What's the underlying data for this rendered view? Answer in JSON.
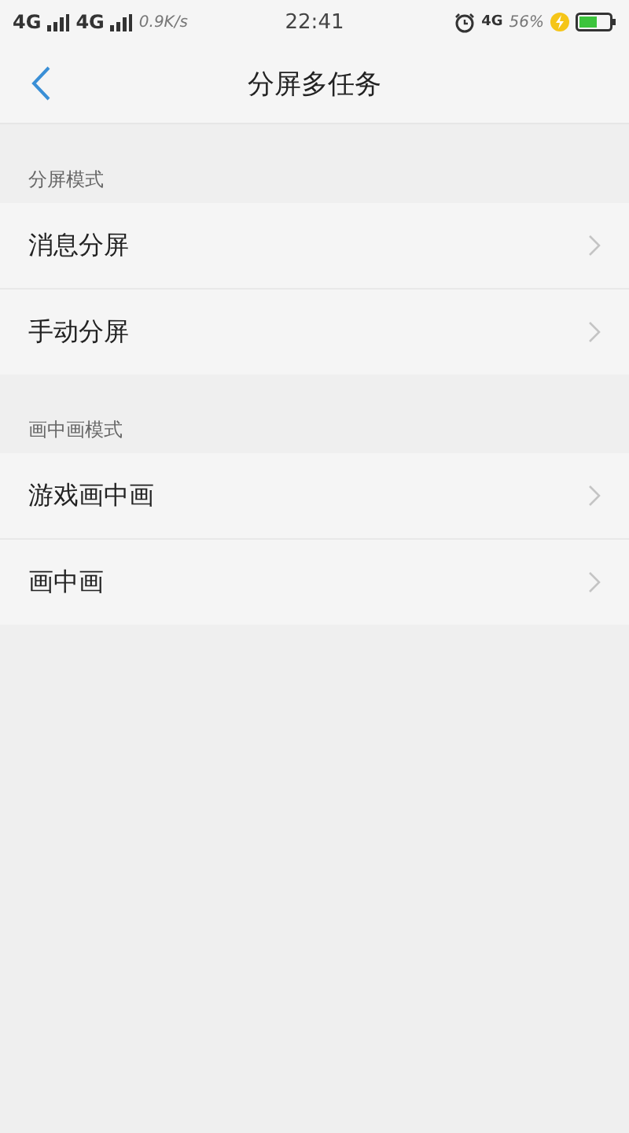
{
  "status_bar": {
    "network_1": "4G",
    "network_2": "4G",
    "speed": "0.9K/s",
    "time": "22:41",
    "network_3": "4G",
    "battery": "56%"
  },
  "header": {
    "title": "分屏多任务"
  },
  "sections": [
    {
      "title": "分屏模式",
      "items": [
        {
          "label": "消息分屏"
        },
        {
          "label": "手动分屏"
        }
      ]
    },
    {
      "title": "画中画模式",
      "items": [
        {
          "label": "游戏画中画"
        },
        {
          "label": "画中画"
        }
      ]
    }
  ]
}
